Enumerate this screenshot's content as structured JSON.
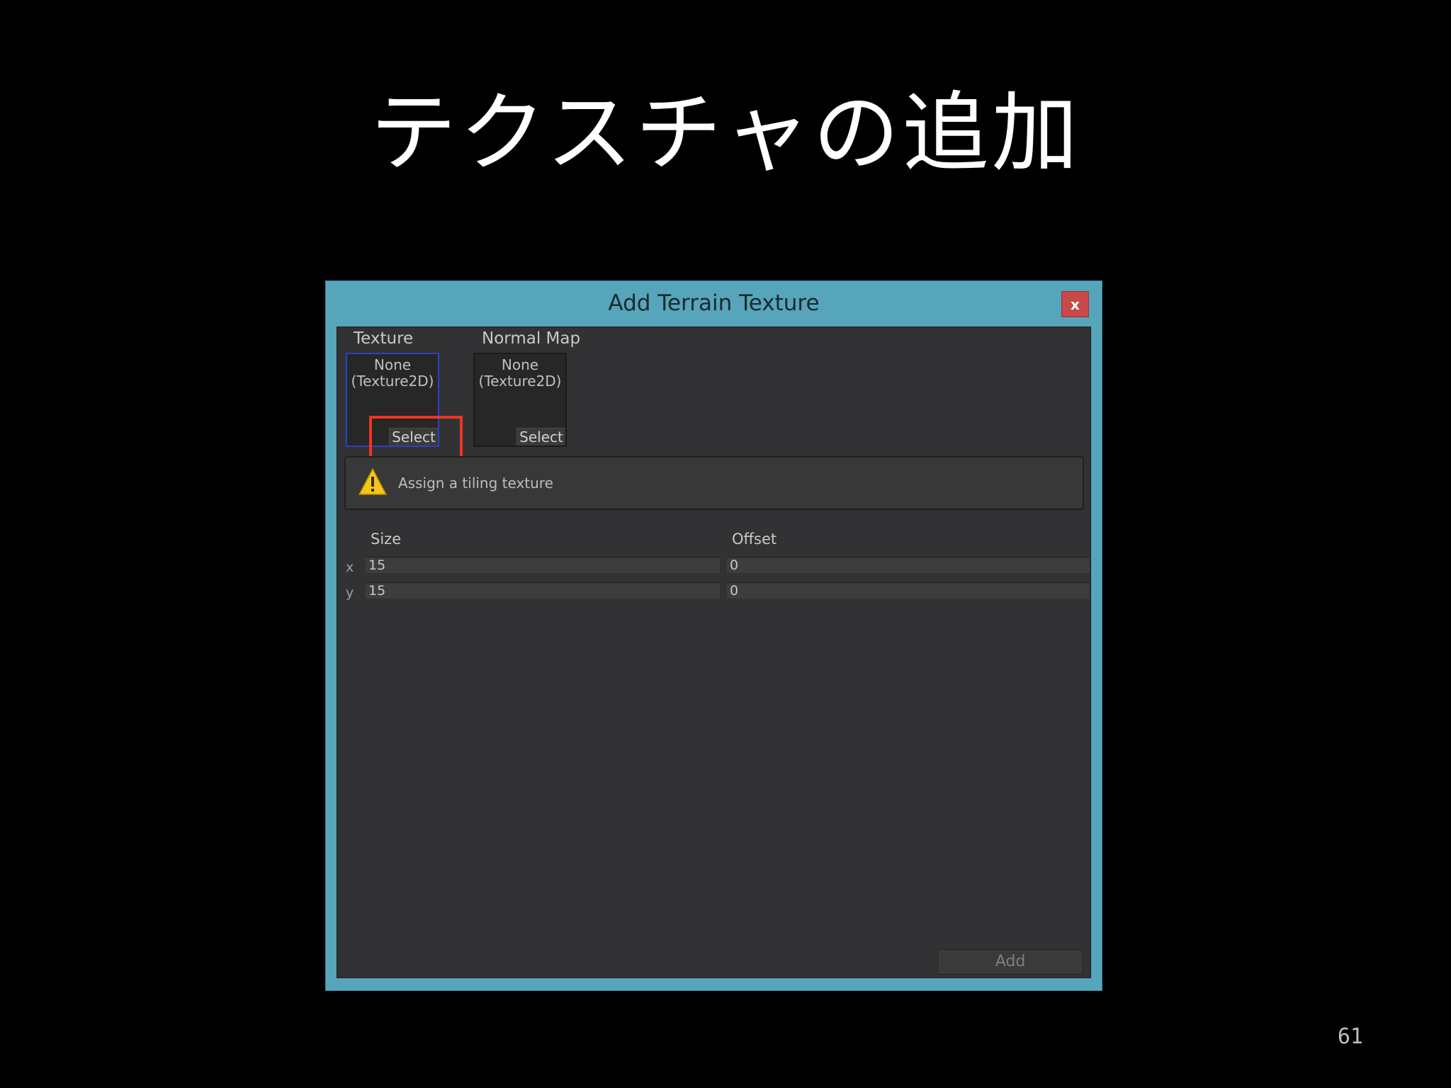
{
  "slide": {
    "title": "テクスチャの追加",
    "page_number": "61"
  },
  "dialog": {
    "title": "Add Terrain Texture",
    "close_label": "x",
    "texture": {
      "label": "Texture",
      "value": "None\n(Texture2D)",
      "select_label": "Select"
    },
    "normal_map": {
      "label": "Normal Map",
      "value": "None\n(Texture2D)",
      "select_label": "Select"
    },
    "help_message": "Assign a tiling texture",
    "size_label": "Size",
    "offset_label": "Offset",
    "x_label": "x",
    "y_label": "y",
    "size_x": "15",
    "size_y": "15",
    "offset_x": "0",
    "offset_y": "0",
    "add_label": "Add"
  },
  "icons": {
    "warning": "warning-triangle-icon"
  },
  "colors": {
    "window_frame": "#56a5bb",
    "close_button": "#c9484a",
    "highlight": "#f0351e",
    "selected_slot": "#2f3ec8"
  }
}
